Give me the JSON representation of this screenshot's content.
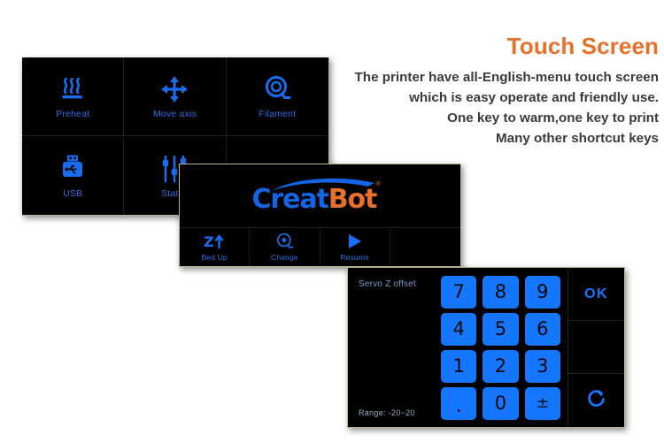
{
  "copy": {
    "title": "Touch Screen",
    "lines": [
      "The printer have all-English-menu touch screen",
      "which is easy operate and friendly use.",
      "One key to warm,one key to print",
      "Many other shortcut keys"
    ]
  },
  "colors": {
    "accent_orange": "#E8702A",
    "accent_blue": "#1464E6",
    "key_blue": "#1577FF",
    "label_blue": "#2f6fe0",
    "screen_black": "#000000",
    "body_text": "#3a3a3a"
  },
  "menu_screen": {
    "items": [
      {
        "label": "Preheat",
        "icon": "heat-waves-icon"
      },
      {
        "label": "Move axis",
        "icon": "four-way-arrow-icon"
      },
      {
        "label": "Filament",
        "icon": "filament-spool-icon"
      },
      {
        "label": "USB",
        "icon": "usb-drive-icon"
      },
      {
        "label": "Status",
        "icon": "sliders-icon"
      },
      {
        "label": "",
        "icon": ""
      }
    ]
  },
  "splash_screen": {
    "logo": {
      "part_blue": "Creat",
      "part_orange": "Bot",
      "registered_mark": "®"
    },
    "buttons": [
      {
        "label": "Bed Up",
        "icon": "z-up-icon",
        "glyph": "Z"
      },
      {
        "label": "Change",
        "icon": "filament-spool-icon",
        "glyph": ""
      },
      {
        "label": "Resume",
        "icon": "play-icon",
        "glyph": ""
      },
      {
        "label": "",
        "icon": "",
        "glyph": ""
      }
    ]
  },
  "keypad_screen": {
    "title": "Servo Z offset",
    "range_label": "Range:  -20~20",
    "keys": [
      "7",
      "8",
      "9",
      "4",
      "5",
      "6",
      "1",
      "2",
      "3",
      ".",
      "0",
      "±"
    ],
    "ok_label": "OK",
    "side_icons": [
      "",
      "",
      "refresh-icon"
    ]
  }
}
